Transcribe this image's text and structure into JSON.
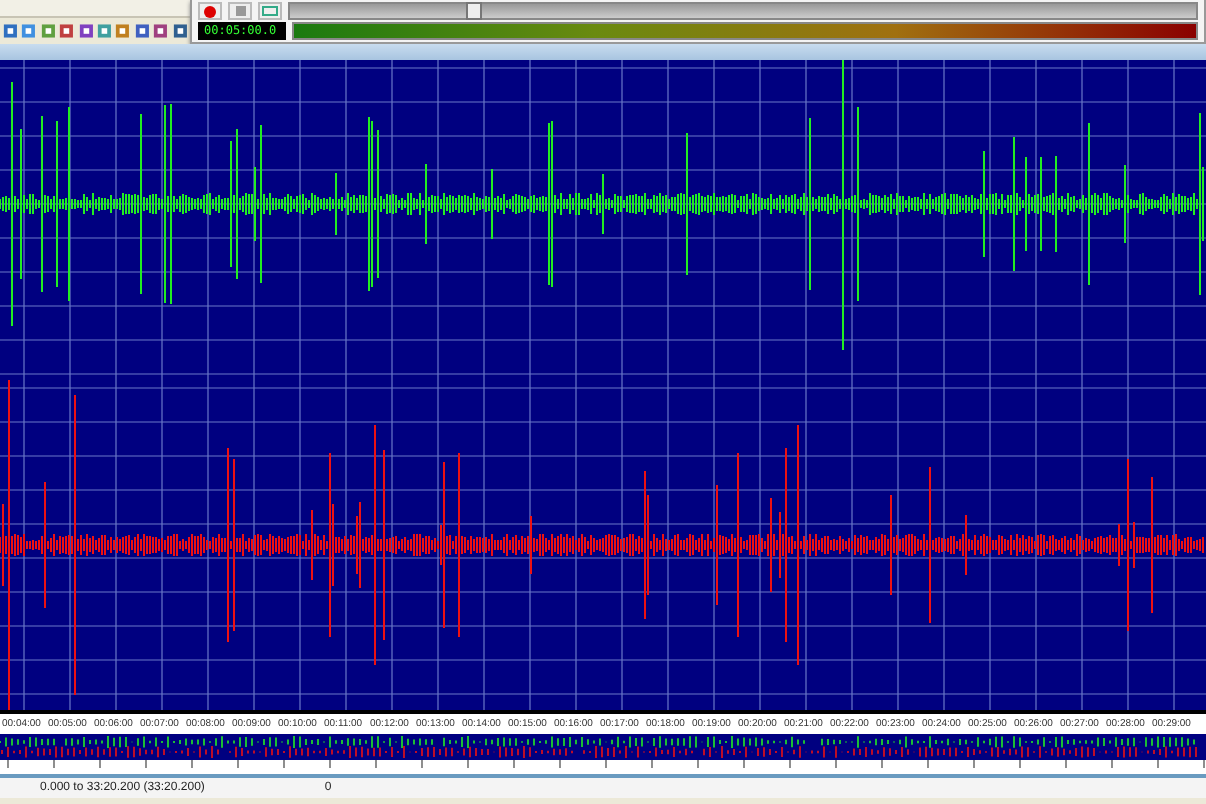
{
  "transport": {
    "time": "00:05:00.0",
    "position": {
      "level": 0.2
    }
  },
  "channels": [
    {
      "color": "#22ee22"
    },
    {
      "color": "#ee1111"
    }
  ],
  "ruler": {
    "labels": [
      "00:04:00",
      "00:05:00",
      "00:06:00",
      "00:07:00",
      "00:08:00",
      "00:09:00",
      "00:10:00",
      "00:11:00",
      "00:12:00",
      "00:13:00",
      "00:14:00",
      "00:15:00",
      "00:16:00",
      "00:17:00",
      "00:18:00",
      "00:19:00",
      "00:20:00",
      "00:21:00",
      "00:22:00",
      "00:23:00",
      "00:24:00",
      "00:25:00",
      "00:26:00",
      "00:27:00",
      "00:28:00",
      "00:29:00"
    ]
  },
  "status": {
    "selection": "0.000 to 33:20.200 (33:20.200)",
    "value": "0"
  }
}
